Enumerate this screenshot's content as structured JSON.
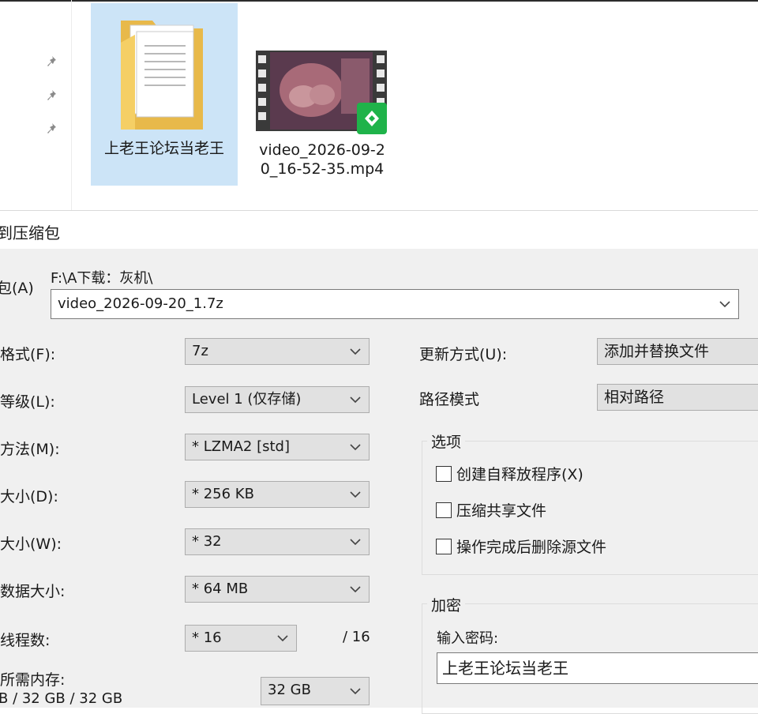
{
  "explorer": {
    "items": [
      {
        "name": "上老王论坛当老王",
        "type": "folder",
        "selected": true
      },
      {
        "name": "video_2026-09-20_16-52-35.mp4",
        "type": "video"
      }
    ],
    "pin_count": 3
  },
  "dialog": {
    "title": "到压缩包",
    "archive": {
      "label": "包(A)",
      "path": "F:\\A下载：灰机\\",
      "value": "video_2026-09-20_1.7z"
    },
    "left_fields": [
      {
        "label": "格式(F):",
        "value": "7z"
      },
      {
        "label": "等级(L):",
        "value": "Level 1 (仅存储)"
      },
      {
        "label": "方法(M):",
        "value": "* LZMA2 [std]"
      },
      {
        "label": "大小(D):",
        "value": "* 256 KB"
      },
      {
        "label": "大小(W):",
        "value": "* 32"
      },
      {
        "label": "数据大小:",
        "value": "* 64 MB"
      },
      {
        "label": "线程数:",
        "value": "* 16"
      }
    ],
    "threads_total": "/ 16",
    "memory": {
      "label": "所需内存:",
      "value": "B / 32 GB / 32 GB",
      "select": "32 GB"
    },
    "update_mode": {
      "label": "更新方式(U):",
      "value": "添加并替换文件"
    },
    "path_mode": {
      "label": "路径模式",
      "value": "相对路径"
    },
    "options": {
      "title": "选项",
      "items": [
        {
          "label": "创建自释放程序(X)",
          "checked": false
        },
        {
          "label": "压缩共享文件",
          "checked": false
        },
        {
          "label": "操作完成后删除源文件",
          "checked": false
        }
      ]
    },
    "encryption": {
      "title": "加密",
      "password_label": "输入密码:",
      "password_value": "上老王论坛当老王"
    }
  },
  "colors": {
    "selection": "#cce4f7",
    "dialog_bg": "#f0f0f0",
    "combo_bg": "#e1e1e1",
    "folder_yellow": "#f8d775",
    "badge_green": "#1fb34a"
  }
}
